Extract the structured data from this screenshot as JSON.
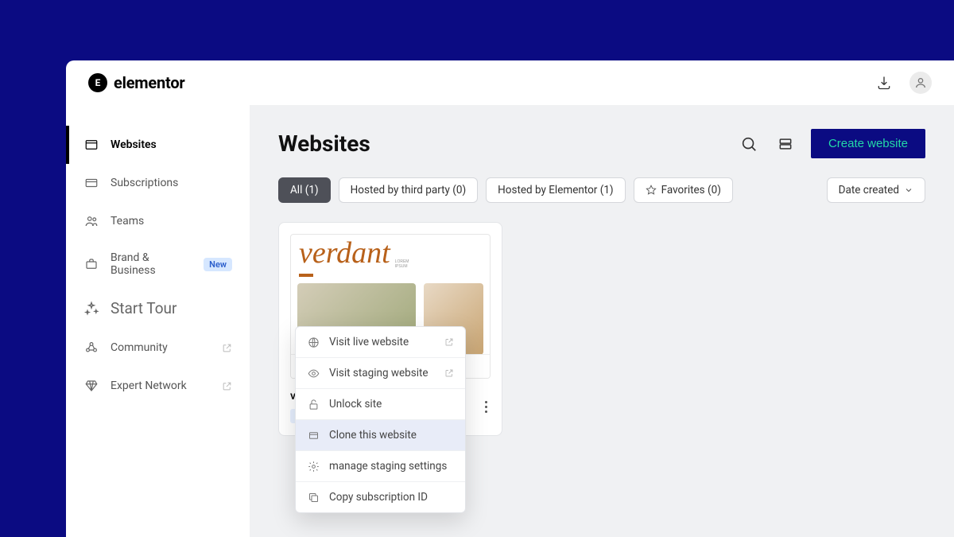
{
  "brand": {
    "name": "elementor",
    "mark": "E"
  },
  "sidebar": {
    "items": [
      {
        "label": "Websites",
        "icon": "window",
        "active": true
      },
      {
        "label": "Subscriptions",
        "icon": "card"
      },
      {
        "label": "Teams",
        "icon": "users"
      },
      {
        "label": "Brand & Business",
        "icon": "briefcase",
        "badge": "New"
      }
    ],
    "tour_label": "Start Tour",
    "community_label": "Community",
    "expert_label": "Expert Network"
  },
  "page": {
    "title": "Websites",
    "create_label": "Create website",
    "sort_label": "Date created"
  },
  "filters": {
    "all": "All (1)",
    "third": "Hosted by third party (0)",
    "elementor": "Hosted by Elementor (1)",
    "favorites": "Favorites (0)"
  },
  "card": {
    "thumb_title": "verdant",
    "name_partial": "verd"
  },
  "dropdown": {
    "visit_live": "Visit live website",
    "visit_staging": "Visit staging website",
    "unlock": "Unlock site",
    "clone": "Clone this website",
    "staging": "manage staging settings",
    "copy_sub": "Copy subscription ID"
  }
}
